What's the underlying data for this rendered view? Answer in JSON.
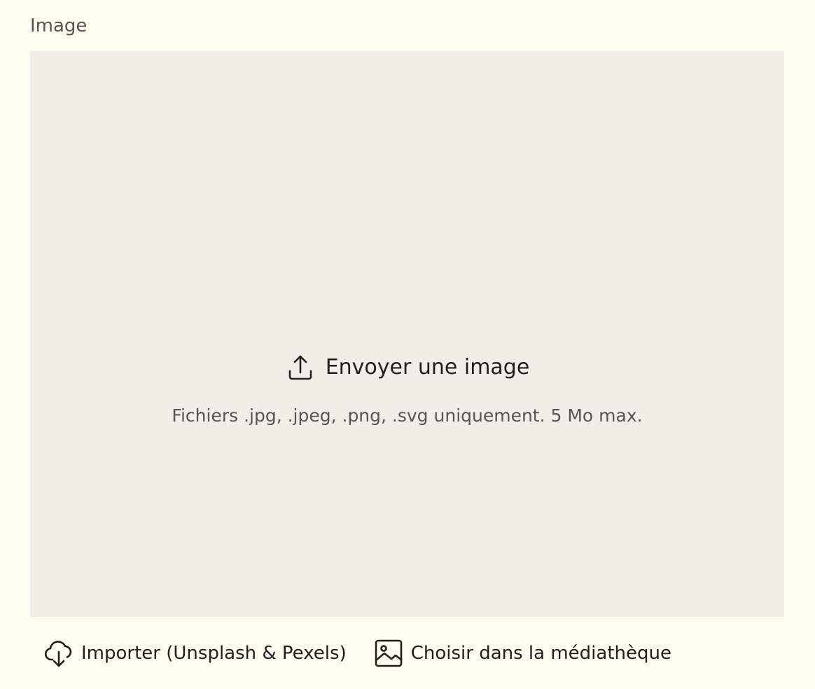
{
  "field": {
    "label": "Image"
  },
  "dropzone": {
    "icon": "upload-icon",
    "title": "Envoyer une image",
    "hint": "Fichiers .jpg, .jpeg, .png, .svg uniquement. 5 Mo max."
  },
  "actions": [
    {
      "icon": "cloud-download-icon",
      "label": "Importer (Unsplash & Pexels)"
    },
    {
      "icon": "image-icon",
      "label": "Choisir dans la médiathèque"
    }
  ],
  "colors": {
    "page_background": "#fffcf0",
    "dropzone_background": "#f1eee7",
    "text_primary": "#1f1f1f",
    "text_secondary": "#555555"
  }
}
